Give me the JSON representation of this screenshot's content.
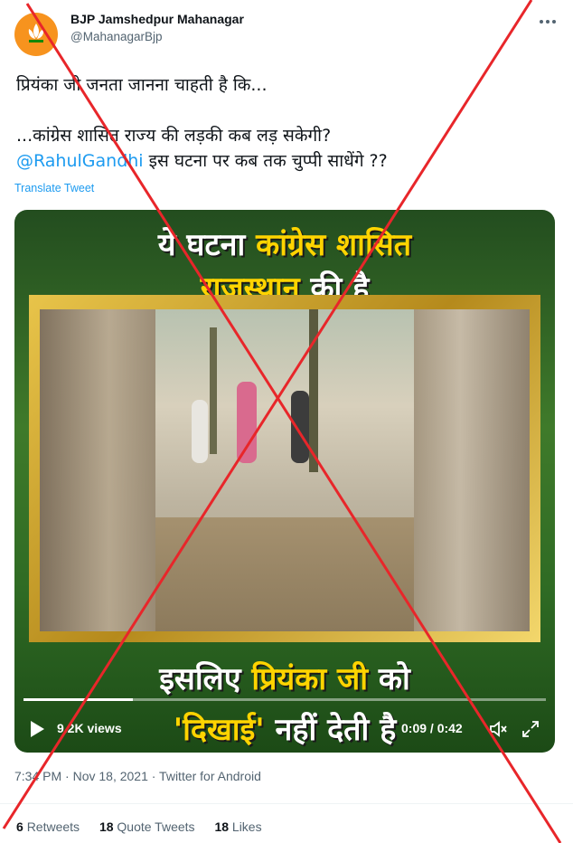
{
  "account": {
    "name": "BJP Jamshedpur Mahanagar",
    "handle": "@MahanagarBjp"
  },
  "tweet": {
    "line1": "प्रियंका जी जनता जानना चाहती है कि...",
    "line2": "...कांग्रेस शासित राज्य की लड़की कब लड़ सकेगी?",
    "mention": "@RahulGandhi",
    "line3_rest": " इस घटना पर कब तक चुप्पी साधेंगे ??",
    "translate_label": "Translate Tweet"
  },
  "video": {
    "banner_top_a": "ये घटना ",
    "banner_top_b": "कांग्रेस शासित",
    "banner_mid_a": "राजस्थान",
    "banner_mid_b": " की है",
    "banner_bottom_a": "इसलिए ",
    "banner_bottom_b": "प्रियंका जी",
    "banner_bottom_c": " को",
    "banner_last_a": "'दिखाई'",
    "banner_last_b": " नहीं देती है",
    "views": "9.2K views",
    "time": "0:09 / 0:42",
    "progress_fraction": 0.21
  },
  "meta": {
    "timestamp": "7:34 PM · Nov 18, 2021 · Twitter for Android"
  },
  "stats": {
    "retweets_count": "6",
    "retweets_label": "Retweets",
    "quotes_count": "18",
    "quotes_label": "Quote Tweets",
    "likes_count": "18",
    "likes_label": "Likes"
  },
  "colors": {
    "accent": "#1d9bf0",
    "cross": "#e8262a",
    "avatar": "#f7931e"
  },
  "icons": [
    "bjp-lotus-icon",
    "more-icon",
    "play-icon",
    "mute-icon",
    "fullscreen-icon"
  ]
}
